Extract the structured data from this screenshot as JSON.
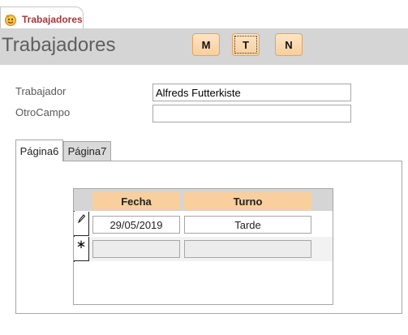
{
  "document_tab": {
    "label": "Trabajadores"
  },
  "header": {
    "title": "Trabajadores",
    "buttons": {
      "m": "M",
      "t": "T",
      "n": "N"
    }
  },
  "fields": {
    "trabajador": {
      "label": "Trabajador",
      "value": "Alfreds Futterkiste"
    },
    "otro_campo": {
      "label": "OtroCampo",
      "value": ""
    }
  },
  "tabs": {
    "pagina6": "Página6",
    "pagina7": "Página7"
  },
  "subform": {
    "columns": [
      "Fecha",
      "Turno"
    ],
    "rows": [
      {
        "fecha": "29/05/2019",
        "turno": "Tarde",
        "selector": "pencil-icon"
      },
      {
        "fecha": "",
        "turno": "",
        "selector": "new-record-icon"
      }
    ]
  },
  "colors": {
    "accent": "#a4373a",
    "header_bg": "#d5d5d5",
    "button_fill": "#f8cf9d",
    "column_header": "#f8cf9d"
  }
}
